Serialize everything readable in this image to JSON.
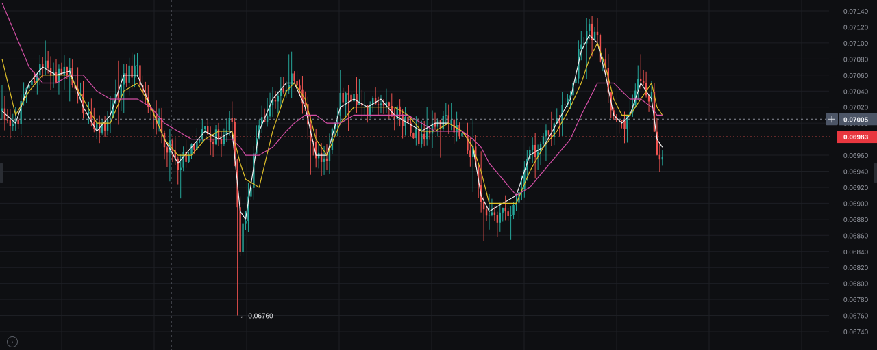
{
  "chart_data": {
    "type": "candlestick",
    "price_axis": {
      "min": 0.0673,
      "max": 0.0715,
      "ticks": [
        0.0674,
        0.0676,
        0.0678,
        0.068,
        0.0682,
        0.0684,
        0.0686,
        0.0688,
        0.069,
        0.0692,
        0.0694,
        0.0696,
        0.0698,
        0.07,
        0.0702,
        0.0704,
        0.0706,
        0.0708,
        0.071,
        0.0712,
        0.0714
      ],
      "tick_labels": [
        "0.06740",
        "0.06760",
        "0.06780",
        "0.06800",
        "0.06820",
        "0.06840",
        "0.06860",
        "0.06880",
        "0.06900",
        "0.06920",
        "0.06940",
        "0.06960",
        "0.06980",
        "0.07000",
        "0.07020",
        "0.07040",
        "0.07060",
        "0.07080",
        "0.07100",
        "0.07120",
        "0.07140"
      ]
    },
    "bar_count": 245,
    "crosshair": {
      "price": 0.07005,
      "label": "0.07005"
    },
    "last_price": {
      "price": 0.06983,
      "label": "0.06983"
    },
    "low_marker": {
      "price": 0.0676,
      "label": "0.06760",
      "bar_index": 87
    },
    "grid": true,
    "series": [
      {
        "kind": "ohlc",
        "anchors": [
          [
            0,
            0.07015
          ],
          [
            5,
            0.06995
          ],
          [
            10,
            0.0705
          ],
          [
            15,
            0.0707
          ],
          [
            20,
            0.0706
          ],
          [
            25,
            0.07065
          ],
          [
            30,
            0.0702
          ],
          [
            35,
            0.0699
          ],
          [
            40,
            0.07005
          ],
          [
            45,
            0.0706
          ],
          [
            50,
            0.07065
          ],
          [
            55,
            0.0702
          ],
          [
            60,
            0.0698
          ],
          [
            65,
            0.0695
          ],
          [
            70,
            0.0697
          ],
          [
            75,
            0.0699
          ],
          [
            80,
            0.0698
          ],
          [
            85,
            0.07
          ],
          [
            88,
            0.0685
          ],
          [
            90,
            0.0688
          ],
          [
            95,
            0.07
          ],
          [
            100,
            0.0703
          ],
          [
            105,
            0.0705
          ],
          [
            108,
            0.0706
          ],
          [
            112,
            0.0702
          ],
          [
            116,
            0.0695
          ],
          [
            120,
            0.0696
          ],
          [
            125,
            0.0703
          ],
          [
            130,
            0.0703
          ],
          [
            135,
            0.0702
          ],
          [
            140,
            0.0703
          ],
          [
            145,
            0.07015
          ],
          [
            150,
            0.07
          ],
          [
            155,
            0.0698
          ],
          [
            160,
            0.07
          ],
          [
            165,
            0.07
          ],
          [
            170,
            0.0699
          ],
          [
            174,
            0.0696
          ],
          [
            177,
            0.069
          ],
          [
            180,
            0.0688
          ],
          [
            185,
            0.0689
          ],
          [
            190,
            0.069
          ],
          [
            195,
            0.0696
          ],
          [
            200,
            0.0698
          ],
          [
            205,
            0.07
          ],
          [
            210,
            0.0703
          ],
          [
            214,
            0.071
          ],
          [
            217,
            0.0712
          ],
          [
            220,
            0.071
          ],
          [
            223,
            0.0706
          ],
          [
            226,
            0.07
          ],
          [
            229,
            0.07
          ],
          [
            232,
            0.0701
          ],
          [
            236,
            0.0706
          ],
          [
            240,
            0.0703
          ],
          [
            242,
            0.0697
          ],
          [
            244,
            0.0696
          ]
        ]
      },
      {
        "kind": "ma",
        "color": "#f0f0f0",
        "anchors": [
          [
            0,
            0.07015
          ],
          [
            5,
            0.07
          ],
          [
            10,
            0.0705
          ],
          [
            15,
            0.0707
          ],
          [
            20,
            0.0706
          ],
          [
            25,
            0.07065
          ],
          [
            30,
            0.0702
          ],
          [
            35,
            0.0699
          ],
          [
            40,
            0.0701
          ],
          [
            45,
            0.0706
          ],
          [
            50,
            0.0706
          ],
          [
            55,
            0.0702
          ],
          [
            60,
            0.0698
          ],
          [
            65,
            0.0695
          ],
          [
            70,
            0.0697
          ],
          [
            75,
            0.0699
          ],
          [
            80,
            0.0698
          ],
          [
            85,
            0.0699
          ],
          [
            88,
            0.0689
          ],
          [
            90,
            0.0688
          ],
          [
            95,
            0.0699
          ],
          [
            100,
            0.0703
          ],
          [
            105,
            0.0705
          ],
          [
            108,
            0.0705
          ],
          [
            112,
            0.0702
          ],
          [
            116,
            0.0696
          ],
          [
            120,
            0.0696
          ],
          [
            125,
            0.0702
          ],
          [
            130,
            0.0703
          ],
          [
            135,
            0.0702
          ],
          [
            140,
            0.0703
          ],
          [
            145,
            0.0701
          ],
          [
            150,
            0.07
          ],
          [
            155,
            0.0699
          ],
          [
            160,
            0.07
          ],
          [
            165,
            0.07
          ],
          [
            170,
            0.0699
          ],
          [
            174,
            0.0697
          ],
          [
            177,
            0.0691
          ],
          [
            180,
            0.0689
          ],
          [
            185,
            0.069
          ],
          [
            190,
            0.0691
          ],
          [
            195,
            0.0696
          ],
          [
            200,
            0.0697
          ],
          [
            205,
            0.07
          ],
          [
            210,
            0.0703
          ],
          [
            214,
            0.0709
          ],
          [
            217,
            0.0711
          ],
          [
            220,
            0.071
          ],
          [
            223,
            0.0706
          ],
          [
            226,
            0.0701
          ],
          [
            229,
            0.07
          ],
          [
            232,
            0.0701
          ],
          [
            236,
            0.0705
          ],
          [
            240,
            0.0703
          ],
          [
            242,
            0.0698
          ],
          [
            244,
            0.0697
          ]
        ]
      },
      {
        "kind": "ma",
        "color": "#e0c02a",
        "anchors": [
          [
            0,
            0.0708
          ],
          [
            5,
            0.0701
          ],
          [
            10,
            0.0704
          ],
          [
            15,
            0.0706
          ],
          [
            20,
            0.0706
          ],
          [
            25,
            0.0706
          ],
          [
            30,
            0.0703
          ],
          [
            35,
            0.07
          ],
          [
            40,
            0.07
          ],
          [
            45,
            0.0704
          ],
          [
            50,
            0.0705
          ],
          [
            55,
            0.0702
          ],
          [
            60,
            0.0698
          ],
          [
            65,
            0.0696
          ],
          [
            70,
            0.0696
          ],
          [
            75,
            0.0698
          ],
          [
            80,
            0.0699
          ],
          [
            85,
            0.0699
          ],
          [
            88,
            0.0695
          ],
          [
            90,
            0.0693
          ],
          [
            95,
            0.0692
          ],
          [
            100,
            0.0699
          ],
          [
            105,
            0.0704
          ],
          [
            108,
            0.0705
          ],
          [
            112,
            0.0703
          ],
          [
            116,
            0.0698
          ],
          [
            120,
            0.0696
          ],
          [
            125,
            0.07
          ],
          [
            130,
            0.0702
          ],
          [
            135,
            0.0702
          ],
          [
            140,
            0.0702
          ],
          [
            145,
            0.0702
          ],
          [
            150,
            0.0701
          ],
          [
            155,
            0.0699
          ],
          [
            160,
            0.0699
          ],
          [
            165,
            0.07
          ],
          [
            170,
            0.0699
          ],
          [
            174,
            0.0697
          ],
          [
            177,
            0.0694
          ],
          [
            180,
            0.069
          ],
          [
            185,
            0.069
          ],
          [
            190,
            0.069
          ],
          [
            195,
            0.0694
          ],
          [
            200,
            0.0697
          ],
          [
            205,
            0.0699
          ],
          [
            210,
            0.0702
          ],
          [
            214,
            0.0705
          ],
          [
            217,
            0.0708
          ],
          [
            220,
            0.071
          ],
          [
            223,
            0.0707
          ],
          [
            226,
            0.0703
          ],
          [
            229,
            0.0701
          ],
          [
            232,
            0.0701
          ],
          [
            236,
            0.0703
          ],
          [
            240,
            0.0705
          ],
          [
            242,
            0.0702
          ],
          [
            244,
            0.0701
          ]
        ]
      },
      {
        "kind": "ma",
        "color": "#d44fa6",
        "anchors": [
          [
            0,
            0.0715
          ],
          [
            5,
            0.0711
          ],
          [
            10,
            0.0707
          ],
          [
            15,
            0.0705
          ],
          [
            20,
            0.0705
          ],
          [
            25,
            0.0706
          ],
          [
            30,
            0.0706
          ],
          [
            35,
            0.0704
          ],
          [
            40,
            0.0703
          ],
          [
            45,
            0.0703
          ],
          [
            50,
            0.0703
          ],
          [
            55,
            0.0702
          ],
          [
            60,
            0.07
          ],
          [
            65,
            0.0699
          ],
          [
            70,
            0.0698
          ],
          [
            75,
            0.0698
          ],
          [
            80,
            0.0698
          ],
          [
            85,
            0.0698
          ],
          [
            88,
            0.0697
          ],
          [
            90,
            0.0696
          ],
          [
            95,
            0.0696
          ],
          [
            100,
            0.0697
          ],
          [
            105,
            0.0699
          ],
          [
            108,
            0.07
          ],
          [
            112,
            0.0701
          ],
          [
            116,
            0.0701
          ],
          [
            120,
            0.07
          ],
          [
            125,
            0.07
          ],
          [
            130,
            0.0701
          ],
          [
            135,
            0.0701
          ],
          [
            140,
            0.0701
          ],
          [
            145,
            0.0701
          ],
          [
            150,
            0.0701
          ],
          [
            155,
            0.07
          ],
          [
            160,
            0.0699
          ],
          [
            165,
            0.0699
          ],
          [
            170,
            0.0699
          ],
          [
            174,
            0.0698
          ],
          [
            177,
            0.0697
          ],
          [
            180,
            0.0695
          ],
          [
            185,
            0.0693
          ],
          [
            190,
            0.0691
          ],
          [
            195,
            0.0692
          ],
          [
            200,
            0.0694
          ],
          [
            205,
            0.0696
          ],
          [
            210,
            0.0698
          ],
          [
            214,
            0.0701
          ],
          [
            217,
            0.0703
          ],
          [
            220,
            0.0705
          ],
          [
            223,
            0.0705
          ],
          [
            226,
            0.0705
          ],
          [
            229,
            0.0704
          ],
          [
            232,
            0.0703
          ],
          [
            236,
            0.0703
          ],
          [
            240,
            0.0702
          ],
          [
            242,
            0.0701
          ],
          [
            244,
            0.0701
          ]
        ]
      }
    ],
    "colors": {
      "background": "#0e0f12",
      "grid": "#1d1f24",
      "up": "#26a69a",
      "down": "#ef5350",
      "axis_text": "#9598a1",
      "crosshair_tag": "#4c5566",
      "last_price_tag": "#e8373f"
    }
  }
}
